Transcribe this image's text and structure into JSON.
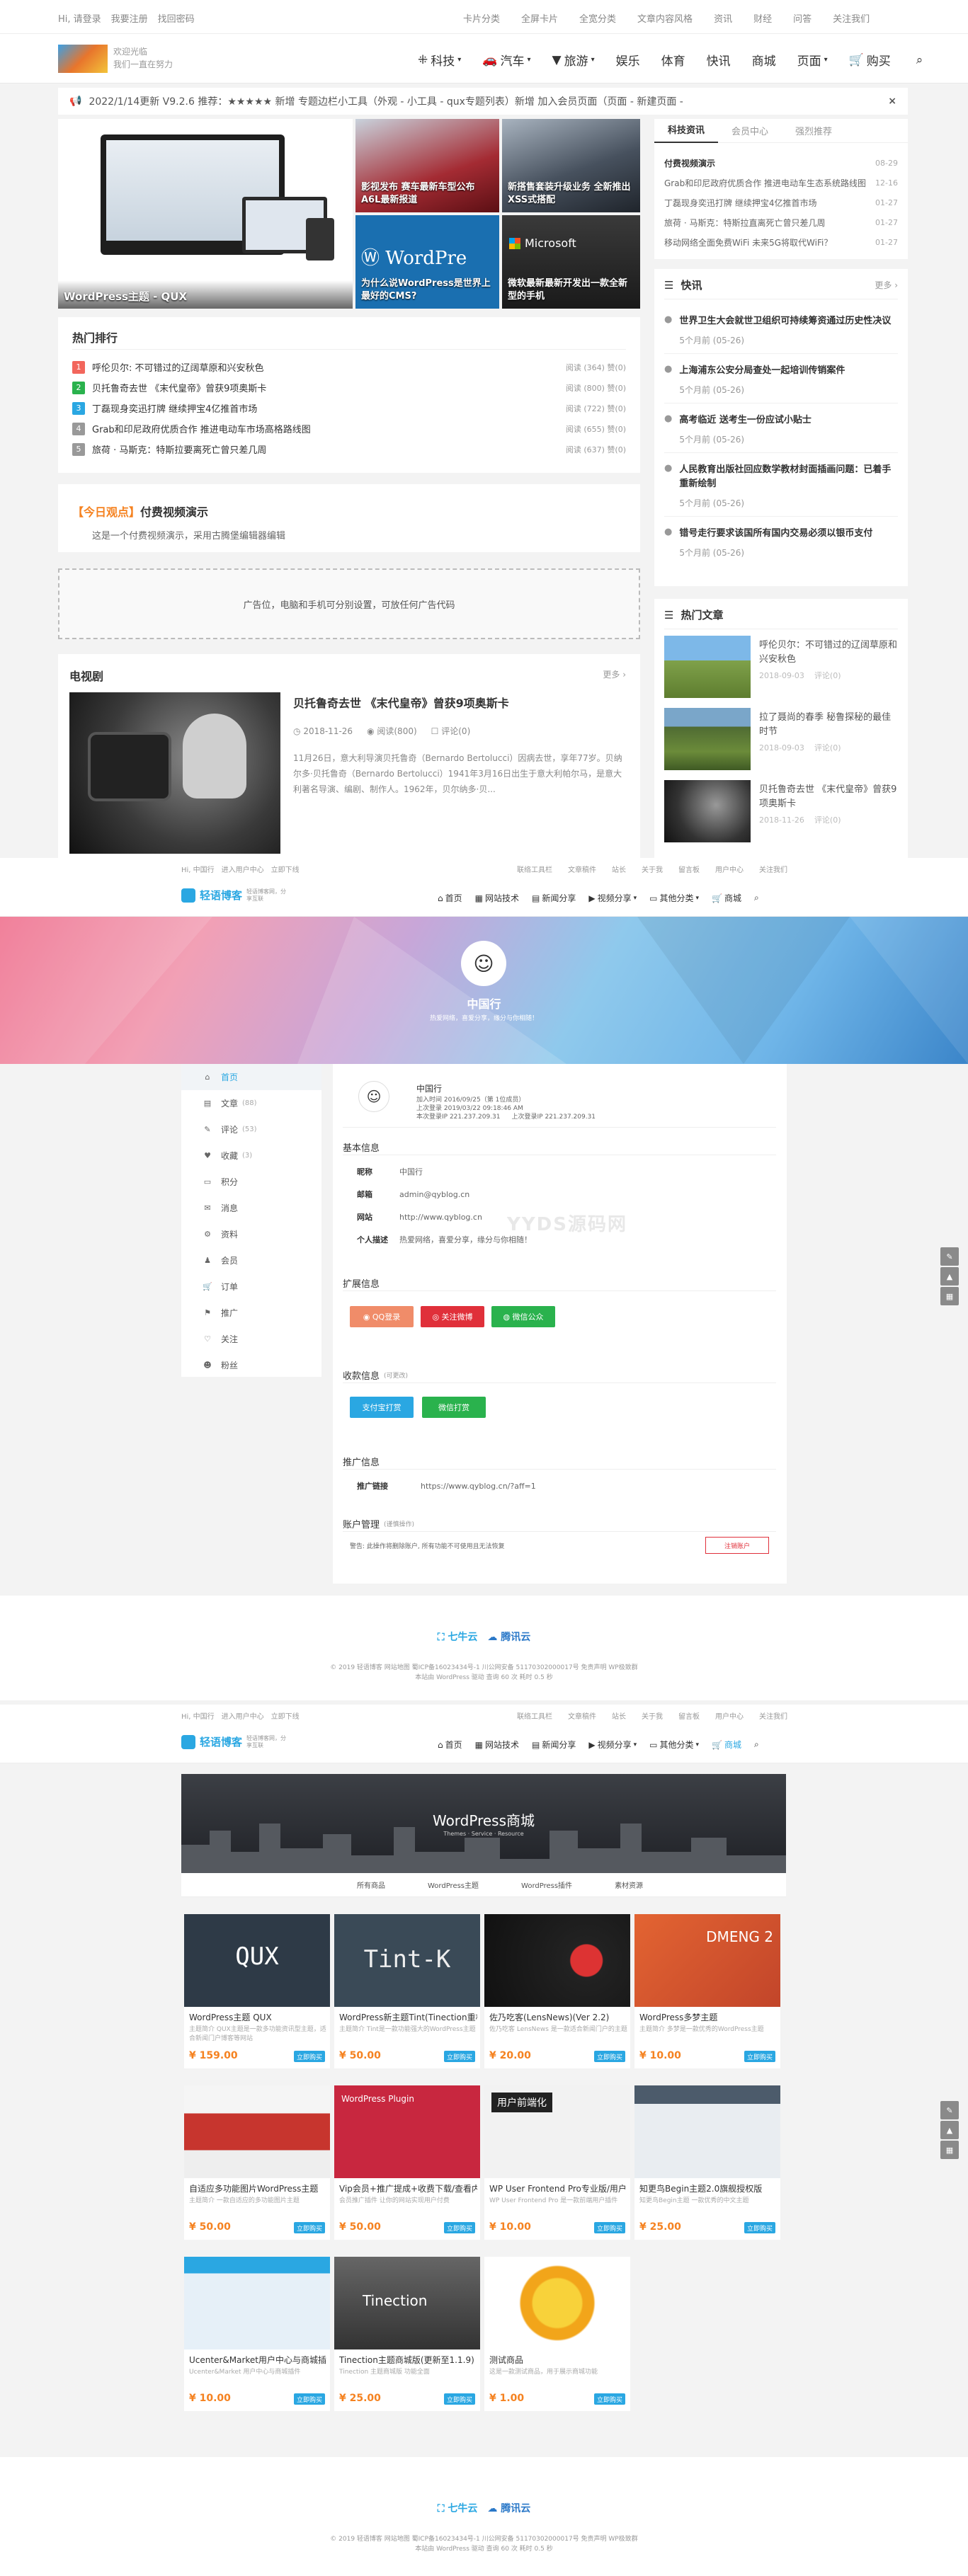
{
  "s1": {
    "topbar": {
      "left": [
        "Hi, 请登录",
        "我要注册",
        "找回密码"
      ],
      "right": [
        "卡片分类",
        "全屏卡片",
        "全宽分类",
        "文章内容风格",
        "资讯",
        "财经",
        "问答",
        "关注我们"
      ]
    },
    "logo": {
      "line1": "欢迎光临",
      "line2": "我们一直在努力"
    },
    "nav": [
      "科技",
      "汽车",
      "旅游",
      "娱乐",
      "体育",
      "快讯",
      "商城",
      "页面",
      "购买"
    ],
    "notice": "2022/1/14更新 V9.2.6 推荐：★★★★★ 新增 专题边栏小工具（外观 - 小工具 - qux专题列表）新增 加入会员页面（页面 - 新建页面 -",
    "slider_caption": "WordPress主题 - QUX",
    "tiles": [
      "影视发布 赛车最新车型公布 A6L最新报道",
      "新搭售套装升级业务 全新推出XSS式搭配",
      "为什么说WordPress是世界上最好的CMS?",
      "微软最新最新开发出一款全新型的手机"
    ],
    "tile_colors": [
      "#b3343a",
      "#475262",
      "#1a6fb0",
      "#2b2b2b"
    ],
    "hot": {
      "title": "热门排行",
      "items": [
        {
          "t": "呼伦贝尔: 不可错过的辽阔草原和兴安秋色",
          "m": "阅读 (364)  赞(0)"
        },
        {
          "t": "贝托鲁奇去世 《末代皇帝》曾获9项奥斯卡",
          "m": "阅读 (800)  赞(0)"
        },
        {
          "t": "丁磊现身奕迅打牌 继续押宝4亿推首市场",
          "m": "阅读 (722)  赞(0)"
        },
        {
          "t": "Grab和印尼政府优质合作 推进电动车市场高格路线图",
          "m": "阅读 (655)  赞(0)"
        },
        {
          "t": "旅荷 · 马斯克：特斯拉要离死亡曾只差几周",
          "m": "阅读 (637)  赞(0)"
        }
      ]
    },
    "opinion": {
      "tag": "【今日观点】",
      "title": "付费视频演示",
      "desc": "这是一个付费视频演示，采用古腾堡编辑器编辑"
    },
    "ad": "广告位，电脑和手机可分别设置，可放任何广告代码",
    "tv": {
      "title": "电视剧",
      "more": "更多",
      "post_title": "贝托鲁奇去世 《末代皇帝》曾获9项奥斯卡",
      "date": "2018-11-26",
      "reads": "阅读(800)",
      "comments": "评论(0)",
      "excerpt": "11月26日，意大利导演贝托鲁奇（Bernardo Bertolucci）因病去世，享年77岁。贝纳尔多·贝托鲁奇（Bernardo Bertolucci）1941年3月16日出生于意大利帕尔马，是意大利著名导演、编剧、制作人。1962年，贝尔纳多·贝..."
    },
    "side": {
      "tabs": [
        "科技资讯",
        "会员中心",
        "强烈推荐"
      ],
      "news": [
        {
          "t": "付费视频演示",
          "d": "08-29"
        },
        {
          "t": "Grab和印尼政府优质合作 推进电动车生态系统路线图",
          "d": "12-16"
        },
        {
          "t": "丁磊现身奕迅打牌 继续押宝4亿推首市场",
          "d": "01-27"
        },
        {
          "t": "旅荷 · 马斯克：特斯拉直离死亡曾只差几周",
          "d": "01-27"
        },
        {
          "t": "移动网络全面免费WiFi 未来5G将取代WiFi？",
          "d": "01-27"
        }
      ]
    },
    "kuaixun": {
      "title": "快讯",
      "more": "更多",
      "items": [
        {
          "t": "世界卫生大会就世卫组织可持续筹资通过历史性决议",
          "d": "5个月前 (05-26)"
        },
        {
          "t": "上海浦东公安分局查处一起培训传销案件",
          "d": "5个月前 (05-26)"
        },
        {
          "t": "高考临近 送考生一份应试小贴士",
          "d": "5个月前 (05-26)"
        },
        {
          "t": "人民教育出版社回应数学教材封面插画问题：已着手重新绘制",
          "d": "5个月前 (05-26)"
        },
        {
          "t": "错号走行要求该国所有国内交易必须以银币支付",
          "d": "5个月前 (05-26)"
        }
      ]
    },
    "hotart": {
      "title": "热门文章",
      "items": [
        {
          "t": "呼伦贝尔：不可错过的辽阔草原和兴安秋色",
          "d": "2018-09-03",
          "c": "评论(0)"
        },
        {
          "t": "拉了聂尚的春季 秘鲁探秘的最佳时节",
          "d": "2018-09-03",
          "c": "评论(0)"
        },
        {
          "t": "贝托鲁奇去世 《末代皇帝》曾获9项奥斯卡",
          "d": "2018-11-26",
          "c": "评论(0)"
        }
      ]
    }
  },
  "s2": {
    "topbar": {
      "left": [
        "Hi, 中国行",
        "进入用户中心",
        "立即下线"
      ],
      "right": [
        "联络工具栏",
        "文章稿件",
        "站长",
        "关于我",
        "留言板",
        "用户中心",
        "关注我们"
      ]
    },
    "logo": "轻语博客",
    "logo_sub": "轻语博客网，分享互联",
    "nav": [
      "首页",
      "网站技术",
      "新闻分享",
      "视频分享",
      "其他分类",
      "商城"
    ],
    "user": {
      "name": "中国行",
      "bio": "热爱网络，喜爱分享，缘分与你相随！"
    },
    "menu": [
      "首页",
      "文章",
      "评论",
      "收藏",
      "积分",
      "消息",
      "资料",
      "会员",
      "订单",
      "推广",
      "关注",
      "粉丝"
    ],
    "menu_counts": [
      "",
      "(88)",
      "(53)",
      "(3)",
      "",
      "",
      "",
      "",
      "",
      "",
      "",
      ""
    ],
    "profile": {
      "name": "中国行",
      "joined": "加入时间 2016/09/25（第 1位成员）",
      "last": "上次登录 2019/03/22 09:18:46 AM",
      "ip1": "本次登录IP 221.237.209.31",
      "ip2": "上次登录IP 221.237.209.31"
    },
    "basic": {
      "title": "基本信息",
      "rows": [
        [
          "昵称",
          "中国行"
        ],
        [
          "邮箱",
          "admin@qyblog.cn"
        ],
        [
          "网站",
          "http://www.qyblog.cn"
        ],
        [
          "个人描述",
          "热爱网络，喜爱分享，缘分与你相随！"
        ]
      ]
    },
    "ext": {
      "title": "扩展信息",
      "btns": [
        "QQ登录",
        "关注微博",
        "微信公众"
      ]
    },
    "pay": {
      "title": "收款信息",
      "sub": "(可更改)",
      "btns": [
        "支付宝打赏",
        "微信打赏"
      ]
    },
    "promo": {
      "title": "推广信息",
      "label": "推广链接",
      "link": "https://www.qyblog.cn/?aff=1"
    },
    "manage": {
      "title": "账户管理",
      "sub": "(谨慎操作)",
      "desc": "警告: 此操作将删除账户, 所有功能不可使用且无法恢复",
      "btn": "注销账户"
    },
    "watermark": "YYDS源码网"
  },
  "s3": {
    "topbar": {
      "left": [
        "Hi, 中国行",
        "进入用户中心",
        "立即下线"
      ],
      "right": [
        "联络工具栏",
        "文章稿件",
        "站长",
        "关于我",
        "留言板",
        "用户中心",
        "关注我们"
      ]
    },
    "banner": {
      "title": "WordPress商城",
      "sub": "Themes · Service · Resource"
    },
    "tabs": [
      "所有商品",
      "WordPress主题",
      "WordPress插件",
      "素材资源"
    ],
    "products": [
      {
        "n": "WordPress主题 QUX",
        "d": "主题简介 QUX主题是一款多功能资讯型主题，适合新闻门户博客等网站",
        "p": "¥ 159.00",
        "b": "#2e3a47",
        "label": "QUX"
      },
      {
        "n": "WordPress新主题Tint(Tinection重构)",
        "d": "主题简介 Tint是一款功能强大的WordPress主题",
        "p": "¥ 50.00",
        "b": "#3a4a57",
        "label": "Tint-K"
      },
      {
        "n": "佐乃吃客(LensNews)(Ver 2.2)",
        "d": "佐乃吃客 LensNews 是一款适合新闻门户的主题",
        "p": "¥ 20.00",
        "b": "#1b1b1b",
        "label": ""
      },
      {
        "n": "WordPress多梦主题",
        "d": "主题简介 多梦是一款优秀的WordPress主题",
        "p": "¥ 10.00",
        "b": "#e36432",
        "label": "DMENG 2"
      },
      {
        "n": "自适应多功能图片WordPress主题",
        "d": "主题简介 一款自适应的多功能图片主题",
        "p": "¥ 50.00",
        "b": "#c7352e",
        "label": ""
      },
      {
        "n": "Vip会员+推广提成+收费下载/查看内",
        "d": "会员推广插件 让你的网站实现用户付费",
        "p": "¥ 50.00",
        "b": "#c8273f",
        "label": "WordPress Plugin"
      },
      {
        "n": "WP User Frontend Pro专业版/用户",
        "d": "WP User Frontend Pro 是一款前端用户插件",
        "p": "¥ 10.00",
        "b": "#f2f2f2",
        "label": "用户前端化"
      },
      {
        "n": "知更鸟Begin主题2.0旗舰授权版",
        "d": "知更鸟Begin主题 一款优秀的中文主题",
        "p": "¥ 25.00",
        "b": "#4c5b6b",
        "label": ""
      },
      {
        "n": "Ucenter&Market用户中心与商城插",
        "d": "Ucenter&Market 用户中心与商城插件",
        "p": "¥ 10.00",
        "b": "#e6f0f8",
        "label": ""
      },
      {
        "n": "Tinection主题商城版(更新至1.1.9)",
        "d": "Tinection 主题商城版 功能全面",
        "p": "¥ 25.00",
        "b": "#555",
        "label": "Tinection"
      },
      {
        "n": "测试商品",
        "d": "这是一款测试商品，用于展示商城功能",
        "p": "¥ 1.00",
        "b": "#f4c12a",
        "label": ""
      }
    ],
    "buy": "立即购买"
  },
  "footer": {
    "logo1": "七牛云",
    "logo2": "腾讯云",
    "line1": "© 2019 轻语博客  网站地图  蜀ICP备16023434号-1  川公网安备 51170302000017号  免责声明  WP极致群",
    "line2": "本站由 WordPress 驱动  查询 60 次  耗时 0.5 秒"
  },
  "colors": {
    "accent": "#2aa7e2",
    "orange": "#f58220",
    "green": "#2ab24d",
    "red": "#e0303a"
  }
}
